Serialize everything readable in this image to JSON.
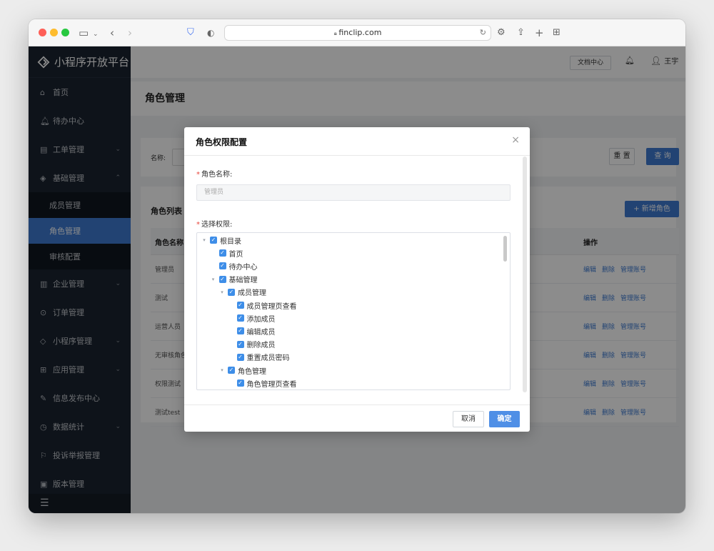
{
  "browser": {
    "url": "finclip.com"
  },
  "sidebar": {
    "brand": "小程序开放平台",
    "items": [
      {
        "icon": "home-icon",
        "label": "首页"
      },
      {
        "icon": "bell-icon",
        "label": "待办中心"
      },
      {
        "icon": "clipboard-icon",
        "label": "工单管理",
        "expandable": true
      },
      {
        "icon": "layers-icon",
        "label": "基础管理",
        "expandable": true,
        "expanded": true
      },
      {
        "icon": "building-icon",
        "label": "企业管理",
        "expandable": true
      },
      {
        "icon": "order-icon",
        "label": "订单管理"
      },
      {
        "icon": "miniprogram-icon",
        "label": "小程序管理",
        "expandable": true
      },
      {
        "icon": "grid-icon",
        "label": "应用管理",
        "expandable": true
      },
      {
        "icon": "edit-icon",
        "label": "信息发布中心"
      },
      {
        "icon": "clock-icon",
        "label": "数据统计",
        "expandable": true
      },
      {
        "icon": "report-icon",
        "label": "投诉举报管理"
      },
      {
        "icon": "version-icon",
        "label": "版本管理"
      }
    ],
    "submenu": [
      {
        "label": "成员管理"
      },
      {
        "label": "角色管理",
        "active": true
      },
      {
        "label": "审核配置"
      }
    ]
  },
  "topbar": {
    "doc_center": "文档中心",
    "user_name": "王宇"
  },
  "page": {
    "title": "角色管理",
    "search_label": "名称:",
    "reset": "重 置",
    "query": "查 询",
    "list_title": "角色列表",
    "add_role": "+ 新增角色",
    "columns": [
      "角色名称",
      "操作"
    ],
    "rows": [
      {
        "name": "管理员"
      },
      {
        "name": "测试"
      },
      {
        "name": "运营人员"
      },
      {
        "name": "无审核角色"
      },
      {
        "name": "权限测试"
      },
      {
        "name": "测试test"
      }
    ],
    "row_actions": [
      "编辑",
      "删除",
      "管理账号"
    ]
  },
  "modal": {
    "title": "角色权限配置",
    "role_name_label": "角色名称:",
    "role_name_value": "管理员",
    "permissions_label": "选择权限:",
    "tree": [
      {
        "label": "根目录",
        "level": 0,
        "arrow": true,
        "checked": true
      },
      {
        "label": "首页",
        "level": 1,
        "arrow": false,
        "checked": true
      },
      {
        "label": "待办中心",
        "level": 1,
        "arrow": false,
        "checked": true
      },
      {
        "label": "基础管理",
        "level": 1,
        "arrow": true,
        "checked": true
      },
      {
        "label": "成员管理",
        "level": 2,
        "arrow": true,
        "checked": true
      },
      {
        "label": "成员管理页查看",
        "level": 3,
        "arrow": false,
        "checked": true
      },
      {
        "label": "添加成员",
        "level": 3,
        "arrow": false,
        "checked": true
      },
      {
        "label": "编辑成员",
        "level": 3,
        "arrow": false,
        "checked": true
      },
      {
        "label": "删除成员",
        "level": 3,
        "arrow": false,
        "checked": true
      },
      {
        "label": "重置成员密码",
        "level": 3,
        "arrow": false,
        "checked": true
      },
      {
        "label": "角色管理",
        "level": 2,
        "arrow": true,
        "checked": true
      },
      {
        "label": "角色管理页查看",
        "level": 3,
        "arrow": false,
        "checked": true
      }
    ],
    "cancel": "取消",
    "confirm": "确定"
  },
  "colors": {
    "primary": "#3e7bd2",
    "sidebar_bg": "#1b2430",
    "checkbox": "#3e8ee8",
    "required": "#e8443a"
  }
}
